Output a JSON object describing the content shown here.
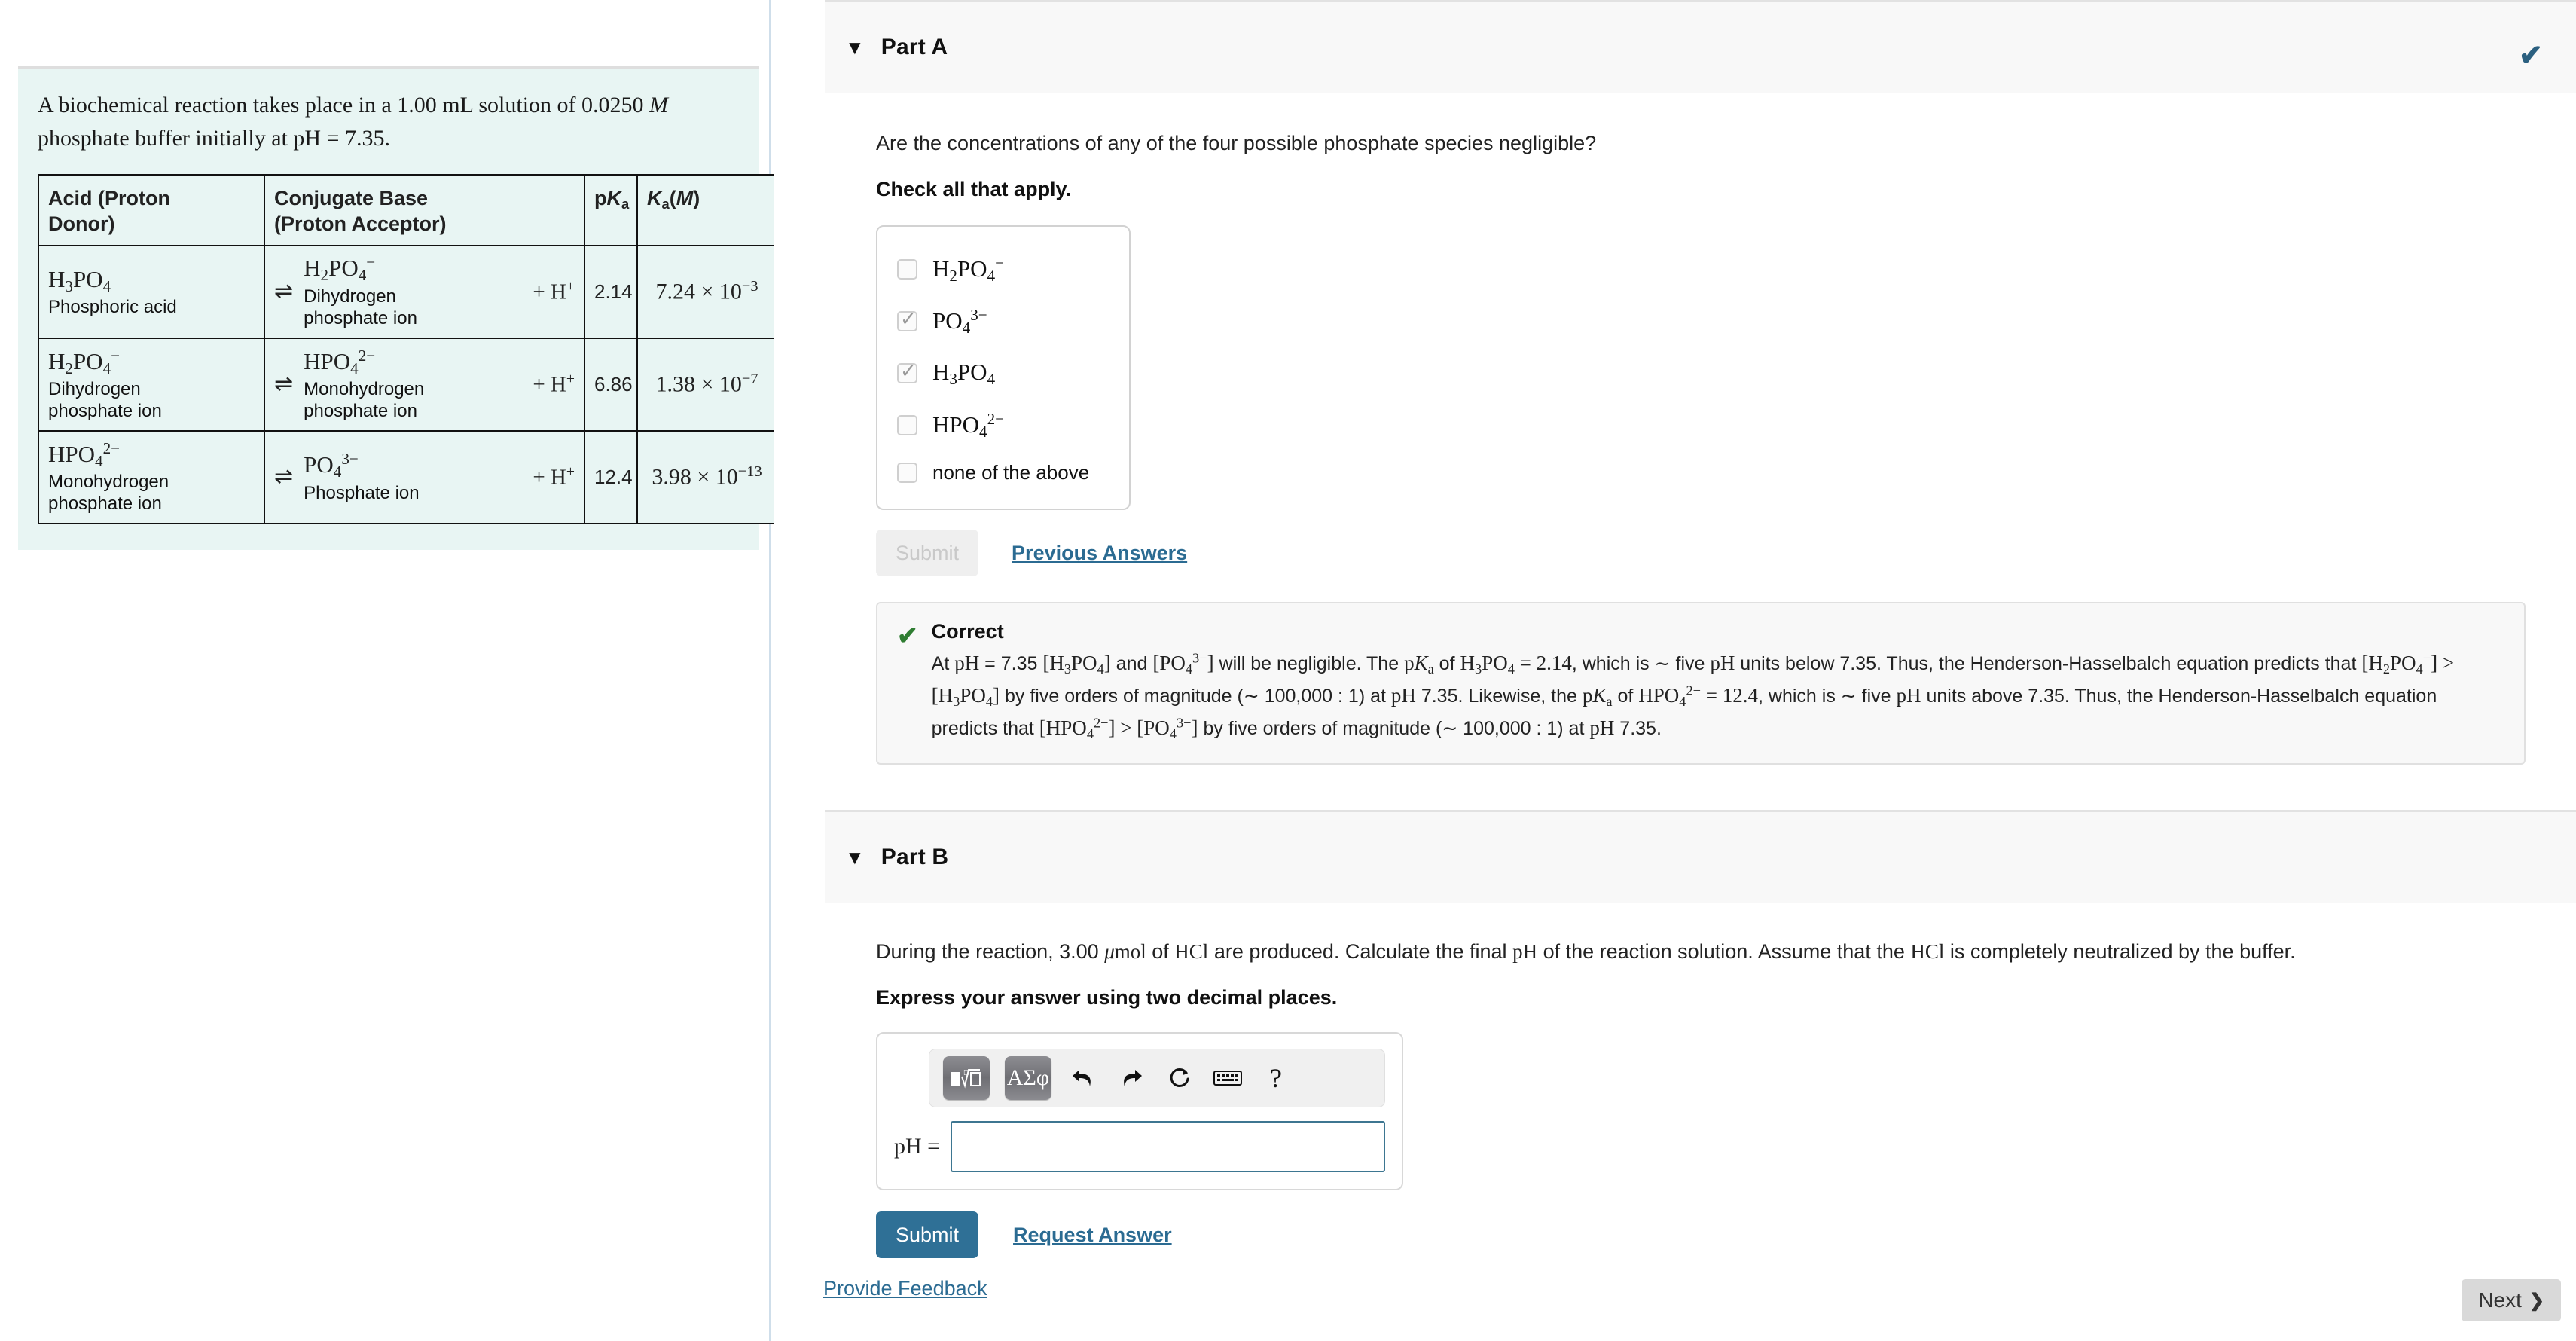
{
  "problem": {
    "statement_parts": [
      "A biochemical reaction takes place in a 1.00 ",
      "mL",
      " solution of 0.0250 ",
      "M",
      " phosphate buffer initially at ",
      "pH",
      " = 7.35."
    ],
    "statement_plain": "A biochemical reaction takes place in a 1.00 mL solution of 0.0250 M phosphate buffer initially at pH = 7.35.",
    "table": {
      "headers": {
        "acid": "Acid (Proton Donor)",
        "acid_line1": "Acid (Proton",
        "acid_line2": "Donor)",
        "base": "Conjugate Base (Proton Acceptor)",
        "base_line1": "Conjugate Base",
        "base_line2": "(Proton Acceptor)",
        "pka": "pKa",
        "ka": "Ka (M)"
      },
      "rows": [
        {
          "acid_formula": "H3PO4",
          "acid_name": "Phosphoric acid",
          "arrow": "⇌",
          "base_formula": "H2PO4−",
          "base_name_line1": "Dihydrogen",
          "base_name_line2": "phosphate ion",
          "plus": "+ H+",
          "pka": "2.14",
          "ka_mantissa": "7.24",
          "ka_exp": "−3"
        },
        {
          "acid_formula": "H2PO4−",
          "acid_name_line1": "Dihydrogen",
          "acid_name_line2": "phosphate ion",
          "arrow": "⇌",
          "base_formula": "HPO42−",
          "base_name_line1": "Monohydrogen",
          "base_name_line2": "phosphate ion",
          "plus": "+ H+",
          "pka": "6.86",
          "ka_mantissa": "1.38",
          "ka_exp": "−7"
        },
        {
          "acid_formula": "HPO42−",
          "acid_name_line1": "Monohydrogen",
          "acid_name_line2": "phosphate ion",
          "arrow": "⇌",
          "base_formula": "PO43−",
          "base_name_line1": "Phosphate ion",
          "base_name_line2": "",
          "plus": "+ H+",
          "pka": "12.4",
          "ka_mantissa": "3.98",
          "ka_exp": "−13"
        }
      ]
    }
  },
  "part_a": {
    "title": "Part A",
    "caret": "▼",
    "status_check": "✔",
    "question": "Are the concentrations of any of the four possible phosphate species negligible?",
    "instruction": "Check all that apply.",
    "choices": [
      {
        "label": "H2PO4−",
        "checked": false
      },
      {
        "label": "PO43−",
        "checked": true
      },
      {
        "label": "H3PO4",
        "checked": true
      },
      {
        "label": "HPO42−",
        "checked": false
      },
      {
        "label": "none of the above",
        "checked": false
      }
    ],
    "submit_label": "Submit",
    "previous_answers_label": "Previous Answers",
    "feedback": {
      "icon": "✔",
      "title": "Correct",
      "text": "At pH = 7.35 [H3PO4] and [PO43−] will be negligible. The pKa of H3PO4 = 2.14, which is ∼ five pH units below 7.35. Thus, the Henderson-Hasselbalch equation predicts that [H2PO4−] > [H3PO4] by five orders of magnitude (∼ 100,000 : 1) at pH 7.35. Likewise, the pKa of HPO42− = 12.4, which is ∼ five pH units above 7.35. Thus, the Henderson-Hasselbalch equation predicts that [HPO42−] > [PO43−] by five orders of magnitude (∼ 100,000 : 1) at pH 7.35."
    }
  },
  "part_b": {
    "title": "Part B",
    "caret": "▼",
    "question": "During the reaction, 3.00 μmol of HCl are produced. Calculate the final pH of the reaction solution. Assume that the HCl is completely neutralized by the buffer.",
    "instruction": "Express your answer using two decimal places.",
    "math_toolbar": [
      {
        "name": "template-button",
        "glyph": "■√☐"
      },
      {
        "name": "greek-button",
        "glyph": "ΑΣφ"
      },
      {
        "name": "undo-icon",
        "glyph": "↰"
      },
      {
        "name": "redo-icon",
        "glyph": "↱"
      },
      {
        "name": "reset-icon",
        "glyph": "↻"
      },
      {
        "name": "keyboard-icon",
        "glyph": "⌨"
      },
      {
        "name": "help-icon",
        "glyph": "?"
      }
    ],
    "answer_prefix": "pH =",
    "answer_value": "",
    "answer_placeholder": "",
    "submit_label": "Submit",
    "request_answer_label": "Request Answer"
  },
  "footer": {
    "provide_feedback_label": "Provide Feedback",
    "next_label": "Next",
    "next_chevron": "❯"
  },
  "colors": {
    "accent_link": "#2b6b92",
    "submit_primary": "#2f7096",
    "correct_green": "#2f7d32",
    "panel_cyan": "#e8f5f3",
    "header_gray": "#f8f8f8"
  }
}
